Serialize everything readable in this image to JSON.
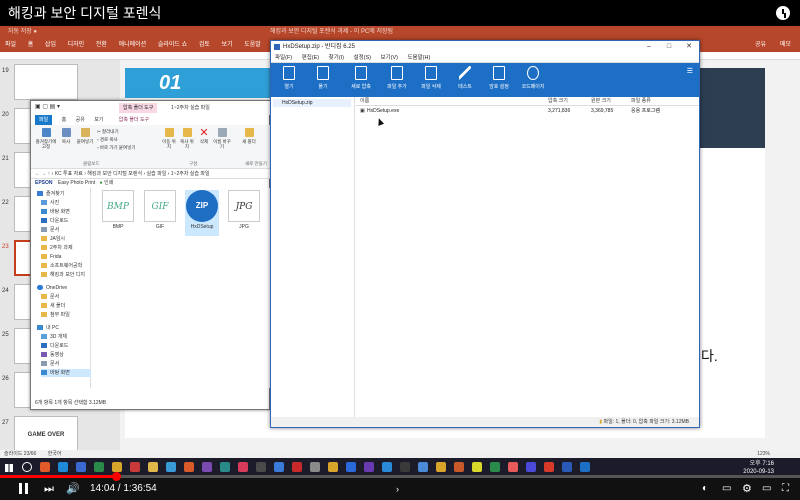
{
  "video": {
    "title": "해킹과 보안 디지털 포렌식",
    "current_time": "14:04",
    "duration": "1:36:54",
    "progress_fraction": 0.145
  },
  "ppt": {
    "title": "해킹과 보안 디지털 포렌식 과제 - 이 PC에 저장됨",
    "tabs": [
      "파일",
      "홈",
      "삽입",
      "디자인",
      "전환",
      "애니메이션",
      "슬라이드 쇼",
      "검토",
      "보기",
      "도움말"
    ],
    "share_label": "공유",
    "comment_label": "메모",
    "slide_numbers": [
      "19",
      "20",
      "21",
      "22",
      "23",
      "24",
      "25",
      "26",
      "27"
    ],
    "slide_badge": "01",
    "slide_text_fragment": "다.",
    "game_over_text": "GAME OVER",
    "status_left": "슬라이드 23/66",
    "status_lang": "한국어",
    "zoom": "123%"
  },
  "explorer": {
    "context_tabs": [
      "압축 폴더 도구",
      "1~2주차 실습 파일"
    ],
    "manage_label": "관리",
    "tabs": [
      "파일",
      "홈",
      "공유",
      "보기",
      "압축 폴더 도구"
    ],
    "ribbon": {
      "pin": "즐겨찾기에 고정",
      "copy": "복사",
      "paste": "붙여넣기",
      "cut": "잘라내기",
      "copy_path": "경로 복사",
      "paste_shortcut": "바로 가기 붙여넣기",
      "move_to": "이동 위치",
      "copy_to": "복사 위치",
      "delete": "삭제",
      "rename": "이름 바꾸기",
      "new_folder": "새 폴더",
      "group_clipboard": "클립보드",
      "group_organize": "구성",
      "group_new": "새로 만들기"
    },
    "address": "› KC 투표 자료 › 해킹과 보안 디지털 포렌식 › 실습 파일 › 1~2주차 실습 파일",
    "epson_bar": "Easy Photo Print",
    "epson_brand": "EPSON",
    "print_label": "인쇄",
    "nav": [
      "즐겨찾기",
      "사진",
      "바탕 화면",
      "다운로드",
      "문서",
      "JA임시",
      "2주차 과제",
      "Frida",
      "소프트웨어공학",
      "해킹과 보안 디지",
      "OneDrive",
      "문서",
      "새 폴더",
      "첨부 파일",
      "내 PC",
      "3D 개체",
      "다운로드",
      "동영상",
      "문서",
      "바탕 화면"
    ],
    "files": [
      {
        "name": "BMP",
        "thumb": "BMP"
      },
      {
        "name": "GIF",
        "thumb": "GIF"
      },
      {
        "name": "HxDSetup",
        "thumb": "ZIP"
      },
      {
        "name": "JPG",
        "thumb": "JPG"
      }
    ],
    "status": "6개 항목    1개 항목 선택함 3.12MB"
  },
  "bandizip": {
    "title": "HxDSetup.zip - 반디집 6.25",
    "menu": [
      "파일(F)",
      "편집(E)",
      "찾기(I)",
      "설정(S)",
      "보기(V)",
      "도움말(H)"
    ],
    "tools": [
      "열기",
      "풀기",
      "새로 압축",
      "파일 추가",
      "파일 삭제",
      "테스트",
      "암호 설정",
      "코드페이지"
    ],
    "tree_item": "HxDSetup.zip",
    "columns": [
      "이름",
      "압축 크기",
      "원본 크기",
      "파일 종류"
    ],
    "rows": [
      {
        "name": "HxDSetup.exe",
        "packed": "3,271,836",
        "size": "3,369,785",
        "type": "응용 프로그램"
      }
    ],
    "status": "파일: 1, 폴더: 0, 압축 파일 크기: 3.12MB"
  },
  "taskbar": {
    "time": "오후 7:16",
    "date": "2020-09-13"
  }
}
